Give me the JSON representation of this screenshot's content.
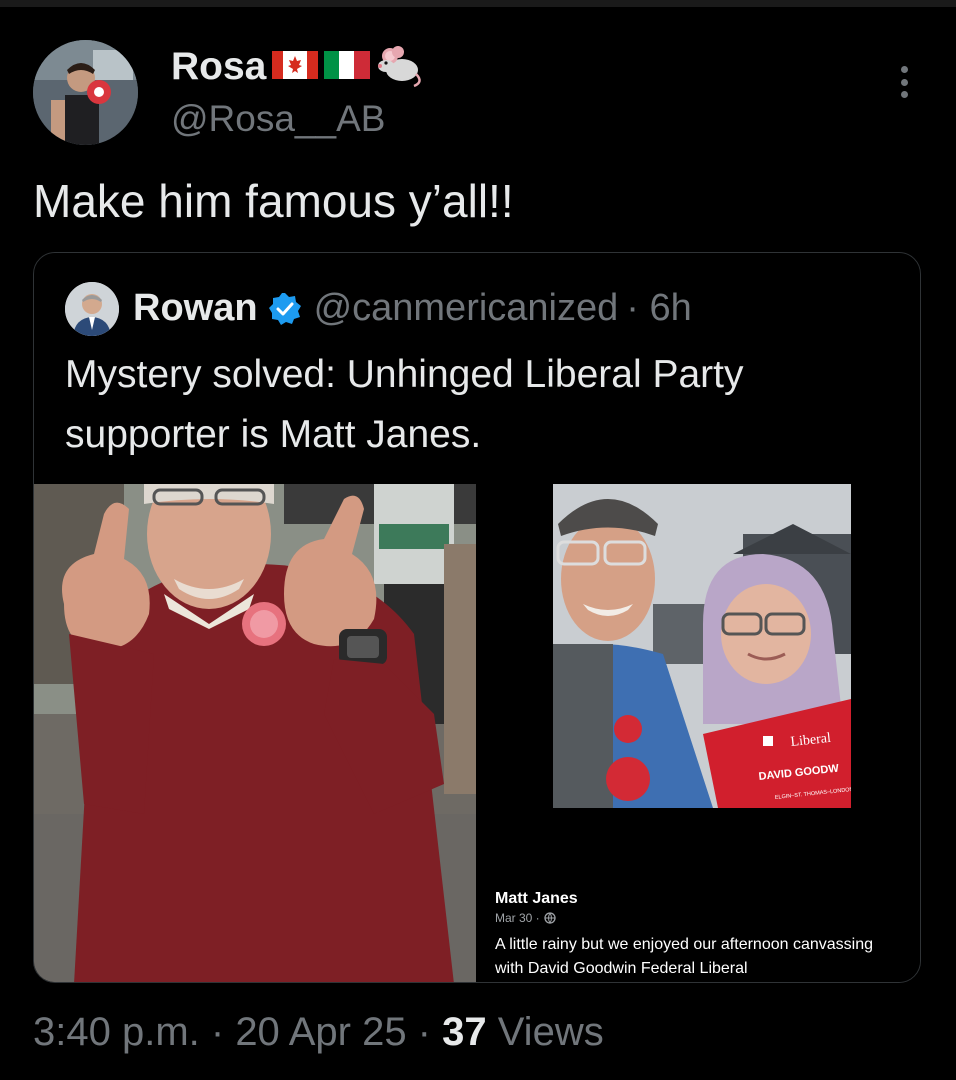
{
  "tweet": {
    "author_name": "Rosa",
    "author_emojis": [
      "canada-flag",
      "italy-flag",
      "mouse"
    ],
    "handle": "@Rosa__AB",
    "text": "Make him famous y’all!!"
  },
  "quoted_tweet": {
    "author_name": "Rowan",
    "verified": true,
    "handle": "@canmericanized",
    "time": "· 6h",
    "text": "Mystery solved: Unhinged Liberal Party supporter is Matt Janes.",
    "facebook_post": {
      "name": "Matt Janes",
      "date": "Mar 30 ·",
      "caption": "A little rainy but we enjoyed our afternoon canvassing with David Goodwin Federal Liberal",
      "sign_brand": "Liberal",
      "sign_candidate": "DAVID GOODW",
      "sign_riding": "ELGIN–ST. THOMAS–LONDON"
    }
  },
  "footer": {
    "time": "3:40 p.m.",
    "sep1": " · ",
    "date": "20 Apr 25",
    "sep2": " · ",
    "views_count": "37",
    "views_label": " Views"
  },
  "colors": {
    "background": "#000000",
    "text_primary": "#e7e9ea",
    "text_secondary": "#71767b",
    "border": "#2f3336",
    "verified_blue": "#1d9bf0"
  }
}
